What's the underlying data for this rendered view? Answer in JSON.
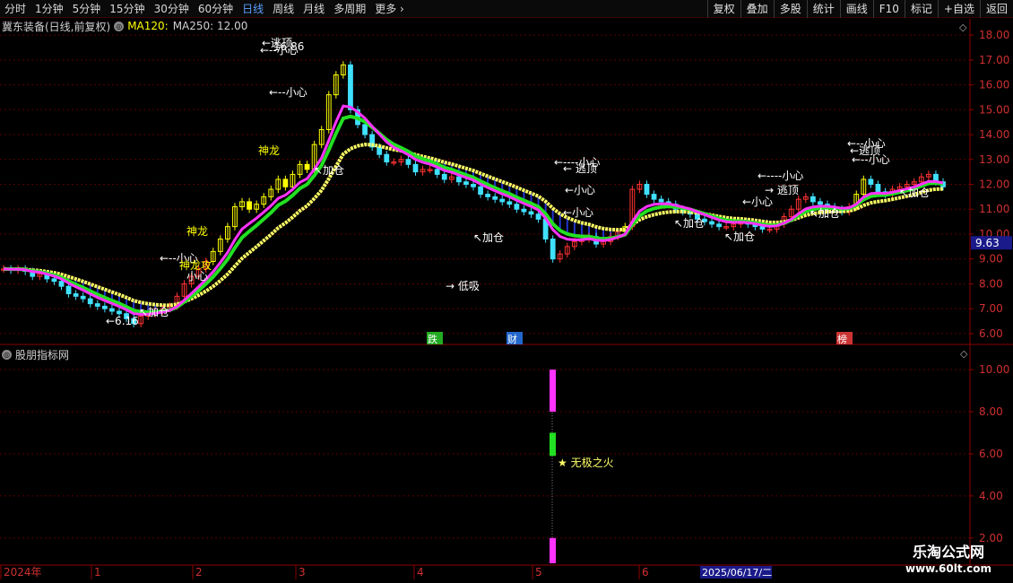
{
  "toolbar": {
    "periods": [
      "分时",
      "1分钟",
      "5分钟",
      "15分钟",
      "30分钟",
      "60分钟",
      "日线",
      "周线",
      "月线",
      "多周期",
      "更多"
    ],
    "active_period": "日线",
    "more_arrow": "›",
    "right_buttons": [
      "复权",
      "叠加",
      "多股",
      "统计",
      "画线",
      "F10",
      "标记",
      "+自选",
      "返回"
    ]
  },
  "main_header": {
    "stock": "冀东装备(日线,前复权)",
    "ma120": "MA120:",
    "ma250": "MA250: 12.00"
  },
  "sub_header": {
    "title": "股朋指标网"
  },
  "price_axis": {
    "ticks": [
      "18.00",
      "17.00",
      "16.00",
      "15.00",
      "14.00",
      "13.00",
      "12.00",
      "11.00",
      "10.00",
      "9.00",
      "8.00",
      "7.00",
      "6.00"
    ],
    "current_price": "9.63"
  },
  "indicator_axis": {
    "ticks": [
      "10.00",
      "8.00",
      "6.00",
      "4.00",
      "2.00"
    ]
  },
  "date_axis": {
    "labels": [
      "2024年",
      "1",
      "2",
      "3",
      "4",
      "5",
      "6"
    ],
    "cursor_date": "2025/06/17/二"
  },
  "event_markers": [
    "跌",
    "财",
    "榜"
  ],
  "annotations": {
    "low_label": "6.16",
    "jiacang": "加仓",
    "xiaoxin": "小心",
    "taoding": "逃顶",
    "dixi": "低吸",
    "shenlong": "神龙",
    "shenlong_attack": "神龙攻",
    "wuji": "★ 无极之火",
    "peak_value": "16.86"
  },
  "watermark": {
    "line1": "乐淘公式网",
    "line2": "www.60lt.com"
  },
  "colors": {
    "up": "#ff3333",
    "down": "#40e0ff",
    "yellow_bar": "#ffff00",
    "ma_slow": "#ffff66",
    "ma_green": "#22e022",
    "ma_magenta": "#ff33ff",
    "axis": "#8b0000",
    "grid": "#5a0000"
  },
  "chart_data": {
    "type": "candlestick",
    "price_ylim": [
      5.6,
      18.4
    ],
    "indicator_ylim": [
      0.8,
      10.6
    ],
    "indicator_bar": {
      "segments": [
        [
          10.0,
          8.0,
          "magenta"
        ],
        [
          7.0,
          5.9,
          "green"
        ],
        [
          2.0,
          0.0,
          "magenta"
        ]
      ]
    }
  }
}
